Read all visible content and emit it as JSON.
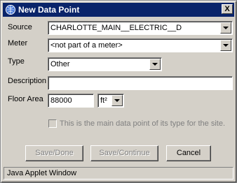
{
  "window": {
    "title": "New Data Point",
    "close_label": "X"
  },
  "form": {
    "source_label": "Source",
    "source_value": "CHARLOTTE_MAIN__ELECTRIC__D",
    "meter_label": "Meter",
    "meter_value": "<not part of a meter>",
    "type_label": "Type",
    "type_value": "Other",
    "description_label": "Description",
    "description_value": "",
    "floor_area_label": "Floor Area",
    "floor_area_value": "88000",
    "floor_area_unit": "ft²",
    "main_point_label": "This is the main data point of its type for the site.",
    "main_point_checked": false
  },
  "buttons": {
    "save_done": "Save/Done",
    "save_continue": "Save/Continue",
    "cancel": "Cancel"
  },
  "status": {
    "text": "Java Applet Window"
  },
  "colors": {
    "titlebar": "#0a246a",
    "window_bg": "#d4d0c8"
  },
  "icons": {
    "title_icon": "app-globe-icon",
    "close": "close-icon",
    "dropdown": "chevron-down-icon"
  }
}
